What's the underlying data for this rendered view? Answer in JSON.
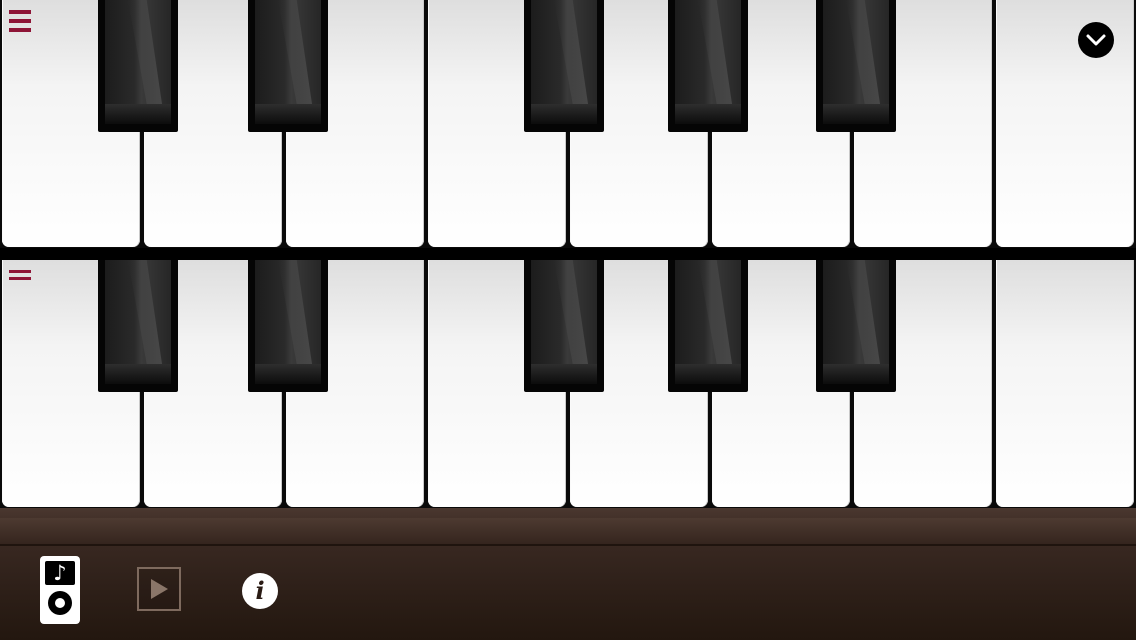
{
  "app": {
    "accent_color": "#8e1537",
    "toolbar_color": "#2e2019"
  },
  "keyboard_top": {
    "white_keys": 8,
    "black_keys": 5,
    "menu_icon": "hamburger-menu-icon",
    "collapse_icon": "chevron-down-icon"
  },
  "keyboard_bottom": {
    "white_keys": 8,
    "black_keys": 5,
    "menu_icon": "hamburger-menu-icon"
  },
  "toolbar": {
    "music_icon": "music-player-icon",
    "music_glyph": "♪",
    "play_icon": "play-icon",
    "info_icon": "info-icon",
    "info_glyph": "i"
  }
}
